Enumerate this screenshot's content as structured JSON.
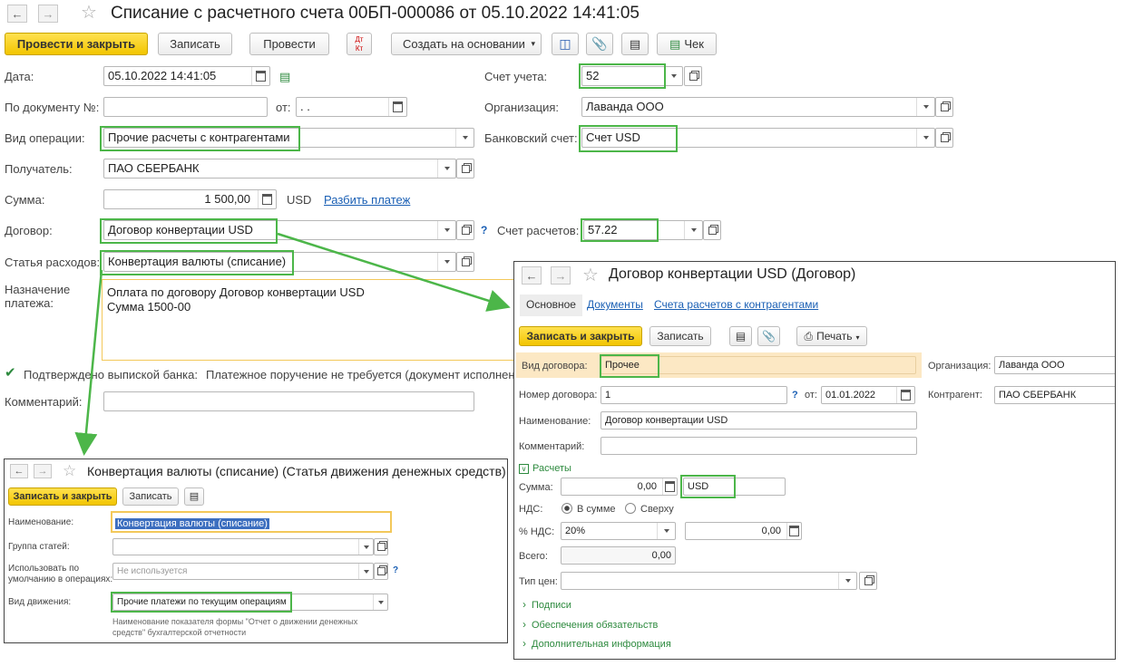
{
  "main": {
    "title": "Списание с расчетного счета 00БП-000086 от 05.10.2022 14:41:05",
    "toolbar": {
      "post_close": "Провести и закрыть",
      "save": "Записать",
      "post": "Провести",
      "dt_kt": "Дт Кт",
      "create_based": "Создать на основании",
      "check": "Чек"
    },
    "fields": {
      "date_label": "Дата:",
      "date_value": "05.10.2022 14:41:05",
      "doc_no_label": "По документу №:",
      "doc_no_value": "",
      "from_label": "от:",
      "from_value": " .  .",
      "op_label": "Вид операции:",
      "op_value": "Прочие расчеты с контрагентами",
      "recipient_label": "Получатель:",
      "recipient_value": "ПАО СБЕРБАНК",
      "sum_label": "Сумма:",
      "sum_value": "1 500,00",
      "currency": "USD",
      "split_link": "Разбить платеж",
      "contract_label": "Договор:",
      "contract_value": "Договор конвертации USD",
      "expense_label": "Статья расходов:",
      "expense_value": "Конвертация валюты (списание)",
      "purpose_label_1": "Назначение",
      "purpose_label_2": "платежа:",
      "purpose_line_1": "Оплата по договору Договор конвертации USD",
      "purpose_line_2": "Сумма 1500-00",
      "confirmed_label": "Подтверждено выпиской банка:",
      "payment_order_note": "Платежное поручение не требуется (документ исполнен",
      "comment_label": "Комментарий:",
      "comment_value": "",
      "account_label": "Счет учета:",
      "account_value": "52",
      "org_label": "Организация:",
      "org_value": "Лаванда ООО",
      "bank_account_label": "Банковский счет:",
      "bank_account_value": "Счет USD",
      "settle_account_label": "Счет расчетов:",
      "settle_account_value": "57.22",
      "help": "?"
    }
  },
  "contract_window": {
    "title": "Договор конвертации USD (Договор)",
    "tabs": [
      "Основное",
      "Документы",
      "Счета расчетов с контрагентами"
    ],
    "toolbar": {
      "save_close": "Записать и закрыть",
      "save": "Записать",
      "print": "Печать"
    },
    "kind_label": "Вид договора:",
    "kind_value": "Прочее",
    "org_label": "Организация:",
    "org_value": "Лаванда ООО",
    "number_label": "Номер договора:",
    "number_value": "1",
    "from_label": "от:",
    "from_value": "01.01.2022",
    "counterparty_label": "Контрагент:",
    "counterparty_value": "ПАО СБЕРБАНК",
    "name_label": "Наименование:",
    "name_value": "Договор конвертации USD",
    "comment_label": "Комментарий:",
    "section_settlements": "Расчеты",
    "sum_label": "Сумма:",
    "sum_value": "0,00",
    "currency_value": "USD",
    "vat_label": "НДС:",
    "vat_in_sum": "В сумме",
    "vat_on_top": "Сверху",
    "vat_pct_label": "% НДС:",
    "vat_pct_value": "20%",
    "vat_amount": "0,00",
    "total_label": "Всего:",
    "total_value": "0,00",
    "price_type_label": "Тип цен:",
    "section_signatures": "Подписи",
    "section_obligations": "Обеспечения обязательств",
    "section_additional": "Дополнительная информация"
  },
  "expense_window": {
    "title": "Конвертация валюты (списание) (Статья движения денежных средств)",
    "toolbar": {
      "save_close": "Записать и закрыть",
      "save": "Записать"
    },
    "name_label": "Наименование:",
    "name_value": "Конвертация валюты (списание)",
    "group_label": "Группа статей:",
    "default_label_1": "Использовать по",
    "default_label_2": "умолчанию в операциях:",
    "default_value": "Не используется",
    "movement_label": "Вид движения:",
    "movement_value": "Прочие платежи по текущим операциям",
    "note": "Наименование показателя формы \"Отчет о движении денежных средств\" бухгалтерской отчетности"
  },
  "colors": {
    "accent": "#f2c500",
    "highlight": "#4cb649",
    "link": "#1a5fb4",
    "focus": "#f3c85a"
  }
}
